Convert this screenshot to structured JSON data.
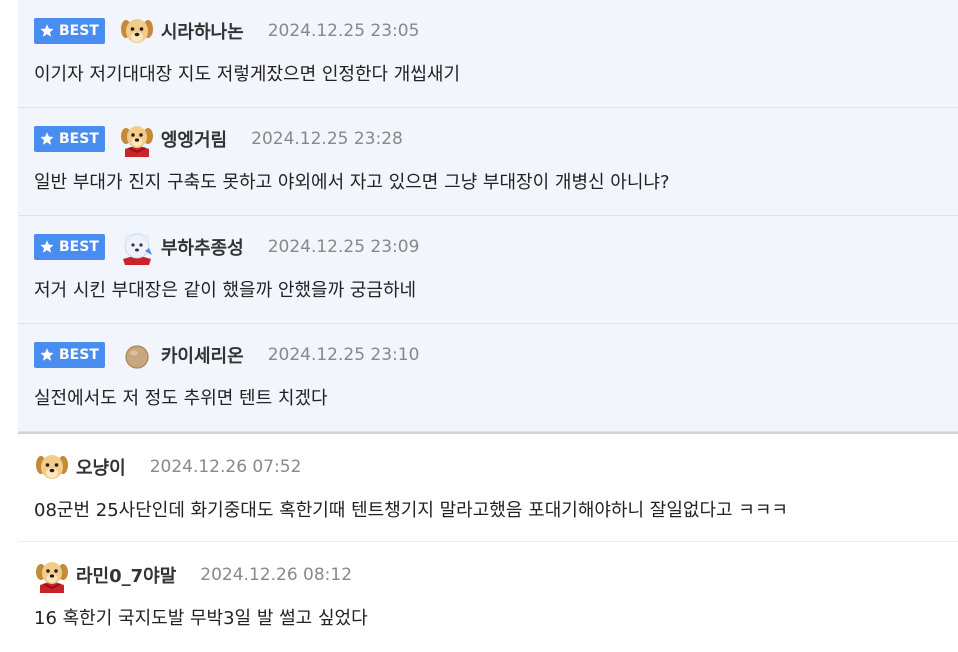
{
  "comments": [
    {
      "best": true,
      "badge": "BEST",
      "avatar": "puppy-icon",
      "nick": "시라하나논",
      "date": "2024.12.25 23:05",
      "text": "이기자 저기대대장 지도 저렇게잤으면 인정한다 개씹새기"
    },
    {
      "best": true,
      "badge": "BEST",
      "avatar": "puppy-red-cape-icon",
      "nick": "엥엥거림",
      "date": "2024.12.25 23:28",
      "text": "일반 부대가 진지 구축도 못하고 야외에서 자고 있으면 그냥 부대장이 개병신 아니냐?"
    },
    {
      "best": true,
      "badge": "BEST",
      "avatar": "white-dog-icon",
      "nick": "부하추종성",
      "date": "2024.12.25 23:09",
      "text": "저거 시킨 부대장은 같이 했을까 안했을까 궁금하네"
    },
    {
      "best": true,
      "badge": "BEST",
      "avatar": "brown-circle-icon",
      "nick": "카이세리온",
      "date": "2024.12.25 23:10",
      "text": "실전에서도 저 정도 추위면 텐트 치겠다"
    },
    {
      "best": false,
      "avatar": "puppy-icon",
      "nick": "오냥이",
      "date": "2024.12.26 07:52",
      "text": "08군번 25사단인데 화기중대도 혹한기때 텐트챙기지 말라고했음 포대기해야하니 잘일없다고 ㅋㅋㅋ"
    },
    {
      "best": false,
      "avatar": "puppy-red-cape-icon",
      "nick": "라민0_7야말",
      "date": "2024.12.26 08:12",
      "text": "16 혹한기 국지도발 무박3일 발 썰고 싶었다"
    }
  ]
}
